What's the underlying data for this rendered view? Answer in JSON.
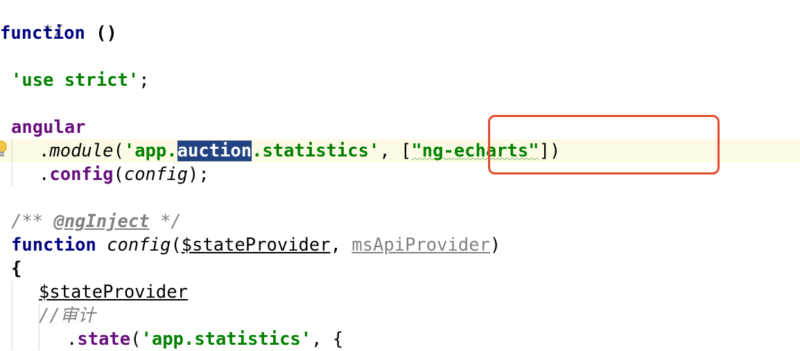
{
  "code": {
    "line1": {
      "comment_end": "*/"
    },
    "line2": {
      "keyword": "function",
      "rest": " ()"
    },
    "line3": {
      "string": "'use strict'",
      "semicolon": ";"
    },
    "line4": {
      "identifier": "angular"
    },
    "line5": {
      "dot": ".",
      "method": "module",
      "open": "(",
      "str_start": "'app.",
      "selected": "auction",
      "str_end": ".statistics'",
      "comma": ", ",
      "bracket_open": "[",
      "dep_string": "\"ng-echarts\"",
      "close": "])"
    },
    "line6": {
      "dot": ".",
      "method": "config",
      "open": "(",
      "arg": "config",
      "close": ");"
    },
    "line7": {
      "comment_start": "/** ",
      "annotation": "@ngInject",
      "comment_end": " */"
    },
    "line8": {
      "keyword": "function",
      "space": " ",
      "name": "config",
      "open": "(",
      "param1": "$stateProvider",
      "comma": ", ",
      "param2": "msApiProvider",
      "close": ")"
    },
    "line9": {
      "brace": "{"
    },
    "line10": {
      "identifier": "$stateProvider"
    },
    "line11": {
      "comment": "//审计"
    },
    "line12": {
      "dot": ".",
      "method": "state",
      "open": "(",
      "string": "'app.statistics'",
      "rest": ", {"
    }
  },
  "colors": {
    "keyword": "#000080",
    "string": "#008000",
    "comment": "#808080",
    "selection": "#214283",
    "highlight_box": "#e4472e",
    "current_line": "#fdfbe5"
  },
  "icons": {
    "gutter": "lightbulb-icon"
  }
}
